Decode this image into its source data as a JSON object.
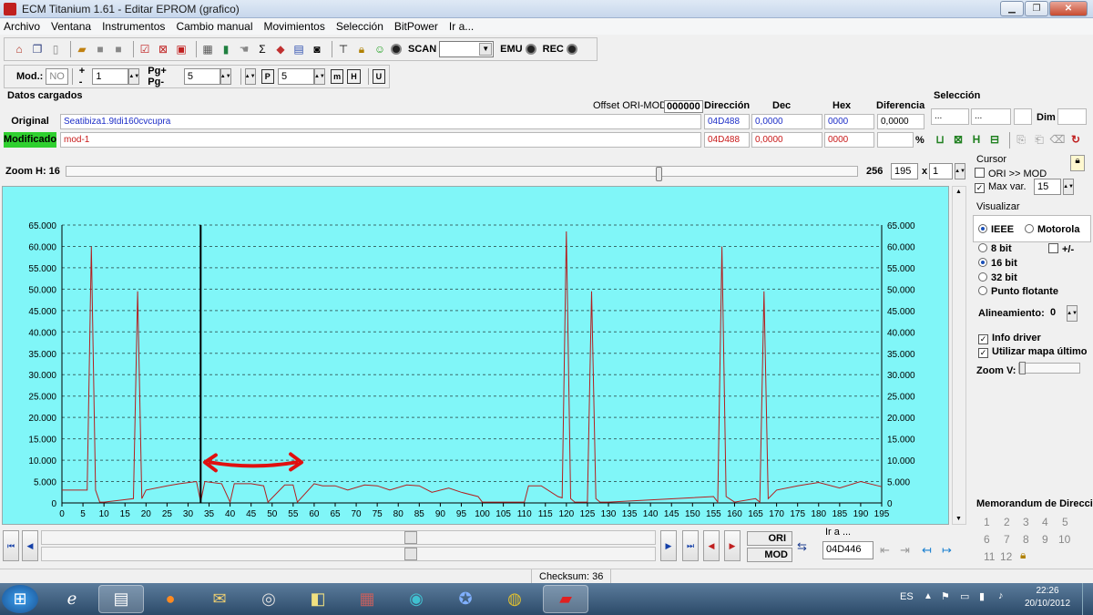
{
  "window": {
    "title": "ECM Titanium 1.61 - Editar EPROM (grafico)"
  },
  "menu": [
    "Archivo",
    "Ventana",
    "Instrumentos",
    "Cambio manual",
    "Movimientos",
    "Selección",
    "BitPower",
    "Ir a..."
  ],
  "toolbar1": {
    "scan_label": "SCAN",
    "emu_label": "EMU",
    "rec_label": "REC"
  },
  "toolbar2": {
    "mod_label": "Mod.:",
    "mod_value": "NO",
    "plusminus_label": "+ -",
    "plusminus_value": "1",
    "pg_label": "Pg+ Pg-",
    "pg_value": "5",
    "p_value": "5"
  },
  "datos": {
    "section_title": "Datos cargados",
    "offset_label": "Offset ORI-MOD",
    "offset_value": "000000",
    "col_direccion": "Dirección",
    "col_dec": "Dec",
    "col_hex": "Hex",
    "col_diferencia": "Diferencia",
    "original": {
      "label": "Original",
      "name": "Seatibiza1.9tdi160cvcupra",
      "direccion": "04D488",
      "dec": "0,0000",
      "hex": "0000",
      "diferencia": "0,0000"
    },
    "modificado": {
      "label": "Modificado",
      "name": "mod-1",
      "direccion": "04D488",
      "dec": "0,0000",
      "hex": "0000",
      "pct": "%"
    }
  },
  "seleccion": {
    "title": "Selección",
    "box1": "...",
    "box2": "...",
    "dim_label": "Dim"
  },
  "zoom": {
    "label": "Zoom H: 16",
    "value": "256",
    "count": "195",
    "times": "x",
    "factor": "1",
    "thumb_fraction": 0.748
  },
  "cursor_panel": {
    "title": "Cursor",
    "ori_mod_label": "ORI >> MOD",
    "max_var_label": "Max var.",
    "max_var_value": "15",
    "visualizar_title": "Visualizar",
    "ieee_label": "IEEE",
    "motorola_label": "Motorola",
    "bit8_label": "8 bit",
    "signed_label": "+/-",
    "bit16_label": "16 bit",
    "bit32_label": "32 bit",
    "float_label": "Punto flotante",
    "alineamiento_label": "Alineamiento:",
    "alineamiento_value": "0",
    "info_driver_label": "Info driver",
    "mapa_ultimo_label": "Utilizar mapa último",
    "zoomv_label": "Zoom V:"
  },
  "memorandum": {
    "title": "Memorandum de Direcciones",
    "numbers": [
      "1",
      "2",
      "3",
      "4",
      "5",
      "6",
      "7",
      "8",
      "9",
      "10",
      "11",
      "12"
    ]
  },
  "bottom": {
    "ori_btn": "ORI",
    "mod_btn": "MOD",
    "ira_label": "Ir a ...",
    "ira_value": "04D446"
  },
  "status": {
    "checksum": "Checksum: 36"
  },
  "taskbar": {
    "lang": "ES",
    "time": "22:26",
    "date": "20/10/2012"
  },
  "colors": {
    "plot_bg": "#80f6f8",
    "line": "#b22020",
    "cursor_line": "#000000",
    "annotation": "#e01010"
  },
  "chart_data": {
    "type": "line",
    "xlim": [
      0,
      195
    ],
    "ylim": [
      0,
      65000
    ],
    "x_ticks": [
      0,
      5,
      10,
      15,
      20,
      25,
      30,
      35,
      40,
      45,
      50,
      55,
      60,
      65,
      70,
      75,
      80,
      85,
      90,
      95,
      100,
      105,
      110,
      115,
      120,
      125,
      130,
      135,
      140,
      145,
      150,
      155,
      160,
      165,
      170,
      175,
      180,
      185,
      190,
      195
    ],
    "y_ticks": [
      "0",
      "5.000",
      "10.000",
      "15.000",
      "20.000",
      "25.000",
      "30.000",
      "35.000",
      "40.000",
      "45.000",
      "50.000",
      "55.000",
      "60.000",
      "65.000"
    ],
    "y_tick_values": [
      0,
      5000,
      10000,
      15000,
      20000,
      25000,
      30000,
      35000,
      40000,
      45000,
      50000,
      55000,
      60000,
      65000
    ],
    "cursor_x": 33,
    "annotation": {
      "type": "double-arrow",
      "x_from": 34,
      "x_to": 57,
      "y": 9500
    },
    "x": [
      0,
      6,
      7,
      8,
      9,
      10,
      17,
      18,
      19,
      20,
      25,
      28,
      32,
      33,
      34,
      38,
      40,
      41,
      45,
      48,
      49,
      53,
      55,
      56,
      60,
      62,
      65,
      68,
      72,
      75,
      78,
      82,
      85,
      88,
      92,
      95,
      99,
      100,
      110,
      111,
      114,
      118,
      119,
      120,
      121,
      122,
      125,
      126,
      127,
      128,
      130,
      155,
      156,
      157,
      158,
      160,
      165,
      166,
      167,
      168,
      170,
      175,
      180,
      185,
      190,
      195
    ],
    "y": [
      3000,
      3000,
      60000,
      3000,
      200,
      200,
      1000,
      49500,
      1000,
      3000,
      4000,
      4500,
      5000,
      300,
      5000,
      4500,
      200,
      4500,
      4500,
      4000,
      200,
      4200,
      4200,
      200,
      4500,
      4000,
      4000,
      3000,
      4200,
      4000,
      3000,
      4200,
      4000,
      2500,
      3500,
      2500,
      1500,
      200,
      200,
      4000,
      4000,
      1500,
      1200,
      63500,
      1000,
      200,
      200,
      49500,
      1000,
      200,
      200,
      1500,
      200,
      60000,
      1500,
      200,
      1000,
      200,
      49500,
      1000,
      3000,
      4000,
      4800,
      3500,
      5000,
      3800
    ]
  }
}
